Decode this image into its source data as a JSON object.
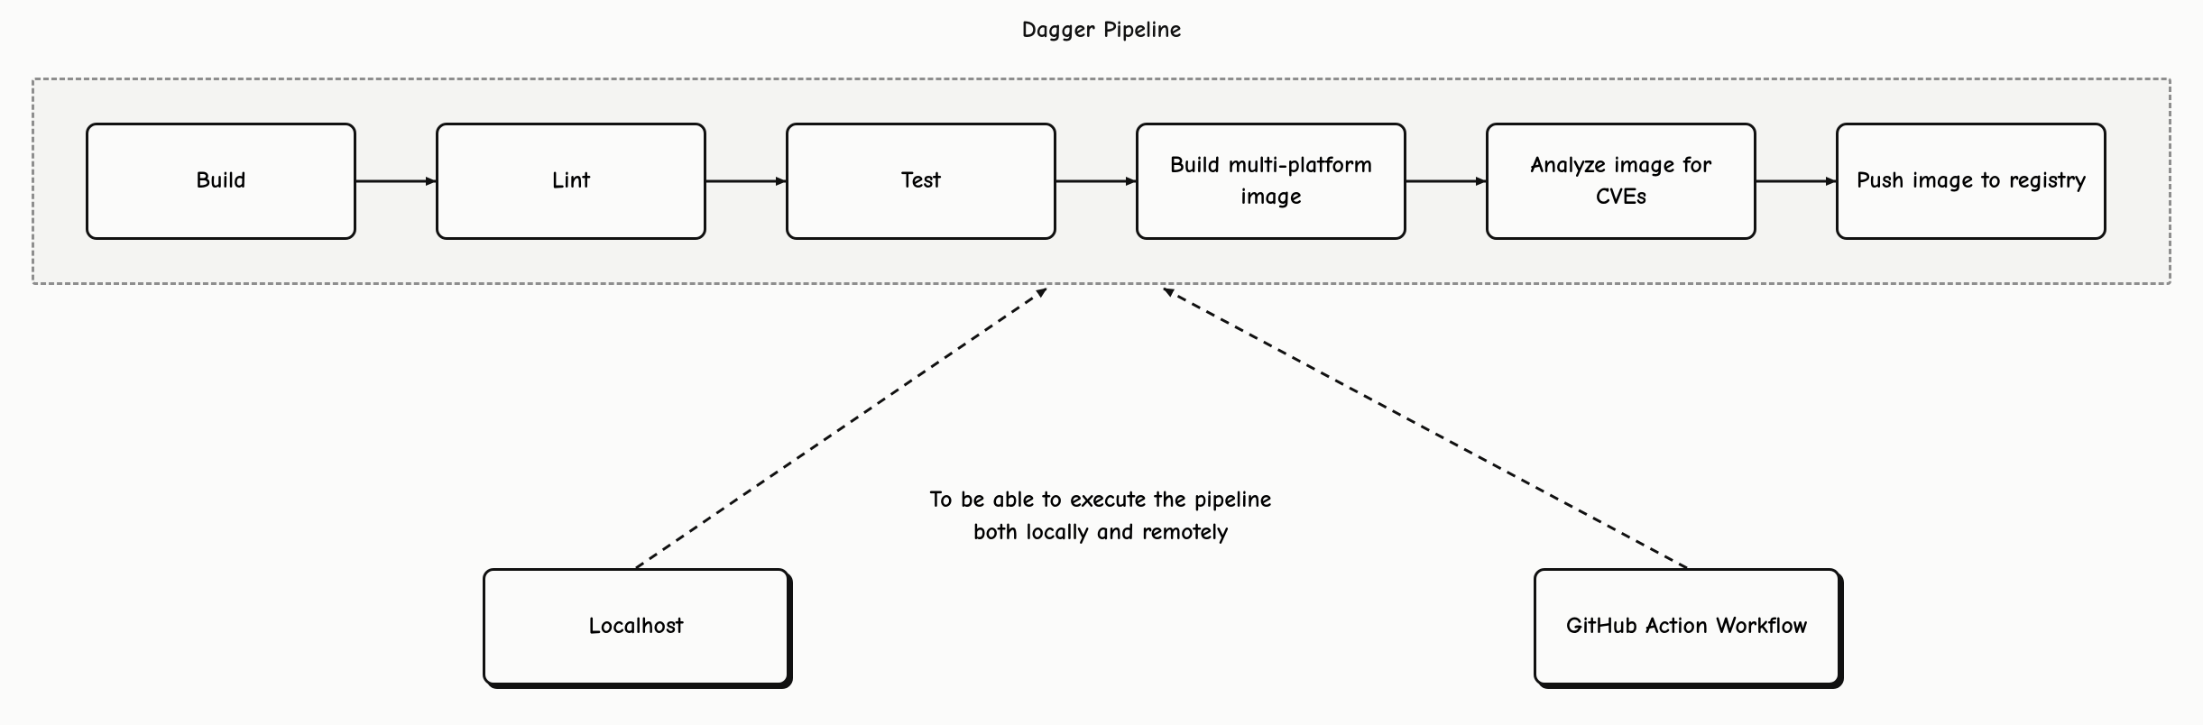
{
  "title": "Dagger Pipeline",
  "stages": [
    {
      "label": "Build"
    },
    {
      "label": "Lint"
    },
    {
      "label": "Test"
    },
    {
      "label": "Build multi-platform image"
    },
    {
      "label": "Analyze image for CVEs"
    },
    {
      "label": "Push image to registry"
    }
  ],
  "caption_line1": "To be able to execute the pipeline",
  "caption_line2": "both locally and remotely",
  "runners": [
    {
      "label": "Localhost"
    },
    {
      "label": "GitHub Action Workflow"
    }
  ]
}
